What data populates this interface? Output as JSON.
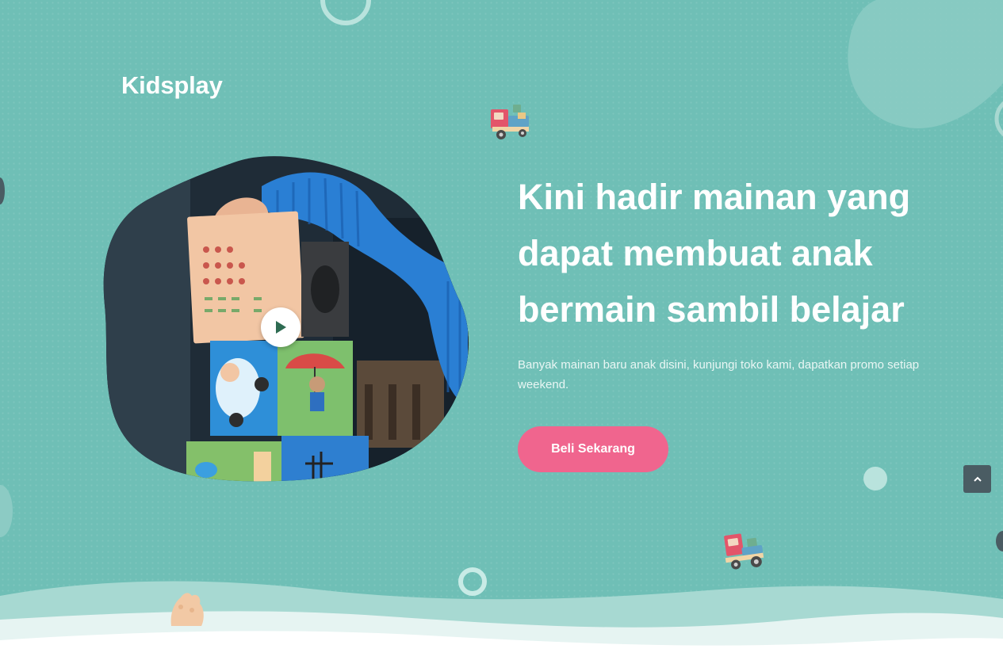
{
  "brand": {
    "name": "Kidsplay"
  },
  "hero": {
    "headline": "Kini hadir mainan yang dapat membuat anak bermain sambil belajar",
    "subtext": "Banyak mainan baru anak disini, kunjungi toko kami, dapatkan promo setiap weekend.",
    "cta_label": "Beli Sekarang",
    "image_icon": "toy-blocks-photo",
    "play_icon": "play-icon"
  },
  "scroll_top": {
    "icon": "chevron-up-icon",
    "glyph": "⌃"
  },
  "colors": {
    "background": "#6fbfb6",
    "cta": "#f0658e",
    "text": "#ffffff",
    "scroll_button": "#4a5c63"
  }
}
